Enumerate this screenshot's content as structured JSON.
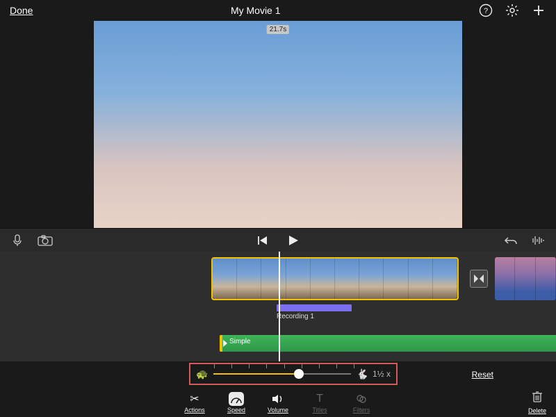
{
  "topbar": {
    "done": "Done",
    "title": "My Movie 1"
  },
  "preview": {
    "duration_badge": "21.7s"
  },
  "timeline": {
    "recording_label": "Recording 1",
    "music_label": "Simple"
  },
  "speed": {
    "value_label": "1½ x",
    "reset": "Reset"
  },
  "toolbar": {
    "actions": "Actions",
    "speed": "Speed",
    "volume": "Volume",
    "titles": "Titles",
    "filters": "Filters",
    "delete": "Delete"
  }
}
